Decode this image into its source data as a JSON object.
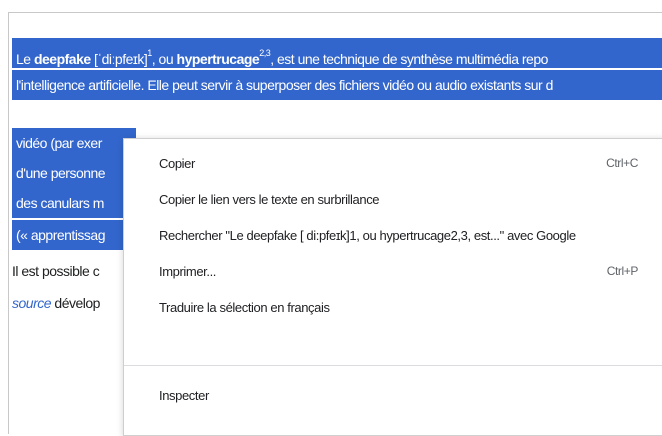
{
  "article": {
    "line1": {
      "t1": "Le ",
      "b1": "deepfake",
      "t2": " [",
      "pron": "ˈdiːpfeɪk",
      "t3": "]",
      "ref1": "1",
      "t4": ", ou ",
      "b2": "hypertrucage",
      "ref2": "2,3",
      "t5": ", est une technique de synthèse multimédia repo"
    },
    "line2": "l'intelligence artificielle. Elle peut servir à superposer des fichiers vidéo ou audio existants sur d",
    "line3": "vidéo (par exer",
    "line4": "d'une personne",
    "line5": "des canulars m",
    "line6": "(« apprentissag",
    "line7": "Il est possible c",
    "line8_link": "source",
    "line8_rest": " dévelop"
  },
  "context_menu": {
    "copy": {
      "label": "Copier",
      "shortcut": "Ctrl+C"
    },
    "copy_link": {
      "label": "Copier le lien vers le texte en surbrillance"
    },
    "search": {
      "label": "Rechercher \"Le deepfake [ di:pfeɪk]1, ou hypertrucage2,3, est...\" avec Google"
    },
    "print": {
      "label": "Imprimer...",
      "shortcut": "Ctrl+P"
    },
    "translate": {
      "label": "Traduire la sélection en français"
    },
    "inspect": {
      "label": "Inspecter"
    }
  },
  "colors": {
    "selection": "#3366cc",
    "link": "#3366cc",
    "text": "#202122",
    "menu_bg": "#ffffff",
    "shortcut": "#5f6368"
  }
}
